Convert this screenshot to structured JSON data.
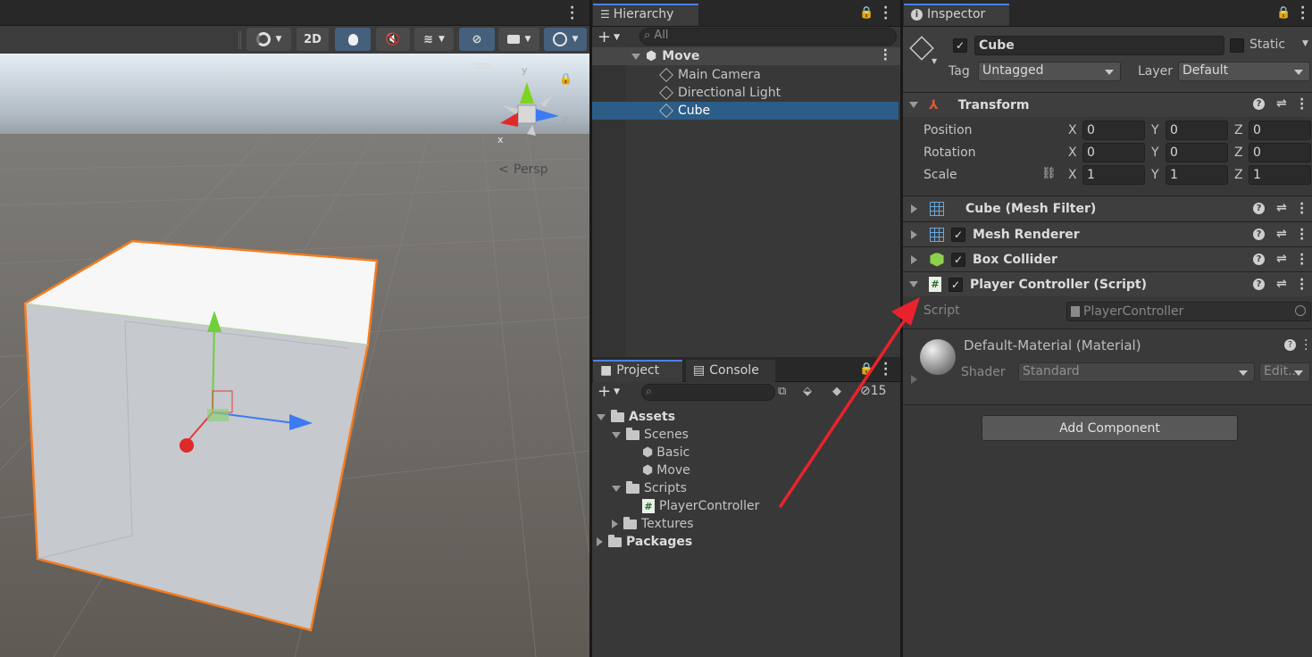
{
  "scene_toolbar": {
    "button_2d": "2D"
  },
  "scene": {
    "view_mode": "Persp",
    "gizmo_axes": {
      "y": "y",
      "x": "x",
      "z": "z"
    }
  },
  "hierarchy": {
    "tab": "Hierarchy",
    "search_placeholder": "All",
    "scene_name": "Move",
    "items": [
      "Main Camera",
      "Directional Light",
      "Cube"
    ],
    "selected": "Cube"
  },
  "project": {
    "tabs": [
      "Project",
      "Console"
    ],
    "hidden_count": "15",
    "tree": {
      "assets": "Assets",
      "scenes": "Scenes",
      "scene_files": [
        "Basic",
        "Move"
      ],
      "scripts": "Scripts",
      "script_files": [
        "PlayerController"
      ],
      "textures": "Textures",
      "packages": "Packages"
    }
  },
  "inspector": {
    "tab": "Inspector",
    "object_name": "Cube",
    "static_label": "Static",
    "tag_label": "Tag",
    "tag_value": "Untagged",
    "layer_label": "Layer",
    "layer_value": "Default",
    "transform": {
      "title": "Transform",
      "rows": [
        {
          "label": "Position",
          "x": "0",
          "y": "0",
          "z": "0"
        },
        {
          "label": "Rotation",
          "x": "0",
          "y": "0",
          "z": "0"
        },
        {
          "label": "Scale",
          "x": "1",
          "y": "1",
          "z": "1"
        }
      ],
      "axis": {
        "x": "X",
        "y": "Y",
        "z": "Z"
      }
    },
    "components": {
      "mesh_filter": "Cube (Mesh Filter)",
      "mesh_renderer": "Mesh Renderer",
      "box_collider": "Box Collider",
      "player_controller": "Player Controller (Script)"
    },
    "script_label": "Script",
    "script_value": "PlayerController",
    "material": {
      "name": "Default-Material (Material)",
      "shader_label": "Shader",
      "shader_value": "Standard",
      "edit_label": "Edit..."
    },
    "add_component": "Add Component"
  },
  "colors": {
    "selection": "#2c5d87",
    "accent_tab": "#4c7fff",
    "cube_outline": "#f57c1f",
    "arrow": "#e8232d"
  }
}
